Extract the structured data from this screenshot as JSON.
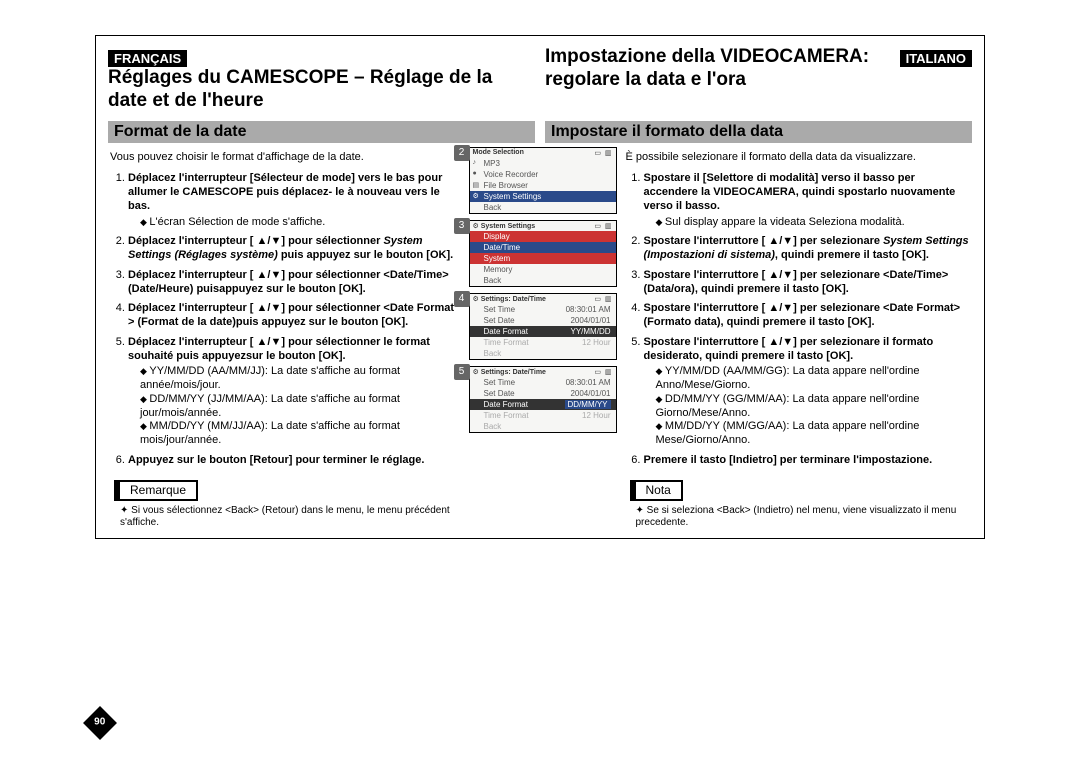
{
  "page_number": "90",
  "fr": {
    "lang_badge": "FRANÇAIS",
    "title": "Réglages du CAMESCOPE – Réglage de la date et de l'heure",
    "section": "Format de la date",
    "intro": "Vous pouvez choisir le format d'affichage de la date.",
    "steps": [
      {
        "n": "1.",
        "b": "Déplacez l'interrupteur [Sélecteur de mode] vers le bas pour allumer le CAMESCOPE puis déplacez- le à nouveau vers le bas.",
        "sub": [
          "L'écran Sélection de mode s'affiche."
        ]
      },
      {
        "n": "2.",
        "b1": "Déplacez l'interrupteur [ ▲/▼] pour sélectionner ",
        "i": "System Settings (Réglages système)",
        "b2": " puis appuyez sur le bouton [OK]."
      },
      {
        "n": "3.",
        "b": "Déplacez l'interrupteur [ ▲/▼] pour sélectionner <Date/Time> (Date/Heure) puisappuyez sur le bouton [OK]."
      },
      {
        "n": "4.",
        "b": "Déplacez l'interrupteur [ ▲/▼] pour sélectionner <Date Format > (Format de la date)puis appuyez sur le bouton [OK]."
      },
      {
        "n": "5.",
        "b": "Déplacez l'interrupteur [ ▲/▼] pour sélectionner le format souhaité puis appuyezsur le bouton [OK].",
        "sub": [
          "YY/MM/DD (AA/MM/JJ): La date s'affiche au format année/mois/jour.",
          "DD/MM/YY (JJ/MM/AA): La date s'affiche au format jour/mois/année.",
          "MM/DD/YY (MM/JJ/AA): La date s'affiche au format mois/jour/année."
        ]
      },
      {
        "n": "6.",
        "b": "Appuyez sur le bouton [Retour] pour terminer le réglage."
      }
    ],
    "note_label": "Remarque",
    "note": "Si vous sélectionnez <Back> (Retour) dans le menu, le menu précédent s'affiche."
  },
  "it": {
    "lang_badge": "ITALIANO",
    "title": "Impostazione della VIDEOCAMERA: regolare la data e l'ora",
    "section": "Impostare il formato della data",
    "intro": "È possibile selezionare il formato della data da visualizzare.",
    "steps": [
      {
        "n": "1.",
        "b": "Spostare il [Selettore di modalità] verso il basso per accendere la VIDEOCAMERA, quindi spostarlo nuovamente verso il basso.",
        "sub": [
          "Sul display appare la videata Seleziona modalità."
        ]
      },
      {
        "n": "2.",
        "b1": "Spostare l'interruttore [ ▲/▼] per selezionare ",
        "i": "System Settings (Impostazioni di sistema)",
        "b2": ", quindi premere il tasto [OK]."
      },
      {
        "n": "3.",
        "b": "Spostare l'interruttore [ ▲/▼] per selezionare <Date/Time> (Data/ora), quindi premere il tasto [OK]."
      },
      {
        "n": "4.",
        "b": "Spostare l'interruttore [ ▲/▼] per selezionare <Date Format> (Formato data), quindi premere il tasto [OK]."
      },
      {
        "n": "5.",
        "b": "Spostare l'interruttore [ ▲/▼] per selezionare il formato desiderato, quindi premere il tasto [OK].",
        "sub": [
          "YY/MM/DD (AA/MM/GG): La data appare nell'ordine Anno/Mese/Giorno.",
          "DD/MM/YY (GG/MM/AA): La data appare nell'ordine Giorno/Mese/Anno.",
          "MM/DD/YY (MM/GG/AA): La data appare nell'ordine Mese/Giorno/Anno."
        ]
      },
      {
        "n": "6.",
        "b": "Premere il tasto [Indietro] per terminare l'impostazione."
      }
    ],
    "note_label": "Nota",
    "note": "Se si seleziona <Back> (Indietro) nel menu, viene visualizzato il menu precedente."
  },
  "screens": {
    "s2": {
      "num": "2",
      "title": "Mode Selection",
      "rows": [
        "MP3",
        "Voice Recorder",
        "File Browser",
        "System Settings",
        "Back"
      ],
      "sel": 3,
      "sel_style": "blue"
    },
    "s3": {
      "num": "3",
      "title": "System Settings",
      "rows": [
        "Display",
        "Date/Time",
        "System",
        "Memory",
        "Back"
      ],
      "sel": 1,
      "sel_style": "blue",
      "red": 0
    },
    "s4": {
      "num": "4",
      "title": "Settings: Date/Time",
      "pairs": [
        [
          "Set Time",
          "08:30:01 AM"
        ],
        [
          "Set Date",
          "2004/01/01"
        ],
        [
          "Date Format",
          "YY/MM/DD"
        ],
        [
          "Time Format",
          "12 Hour"
        ],
        [
          "Back",
          ""
        ]
      ],
      "sel": 2,
      "sel_style": "dark"
    },
    "s5": {
      "num": "5",
      "title": "Settings: Date/Time",
      "pairs": [
        [
          "Set Time",
          "08:30:01 AM"
        ],
        [
          "Set Date",
          "2004/01/01"
        ],
        [
          "Date Format",
          "DD/MM/YY"
        ],
        [
          "Time Format",
          "12 Hour"
        ],
        [
          "Back",
          ""
        ]
      ],
      "sel": 2,
      "sel_style": "dark"
    }
  }
}
